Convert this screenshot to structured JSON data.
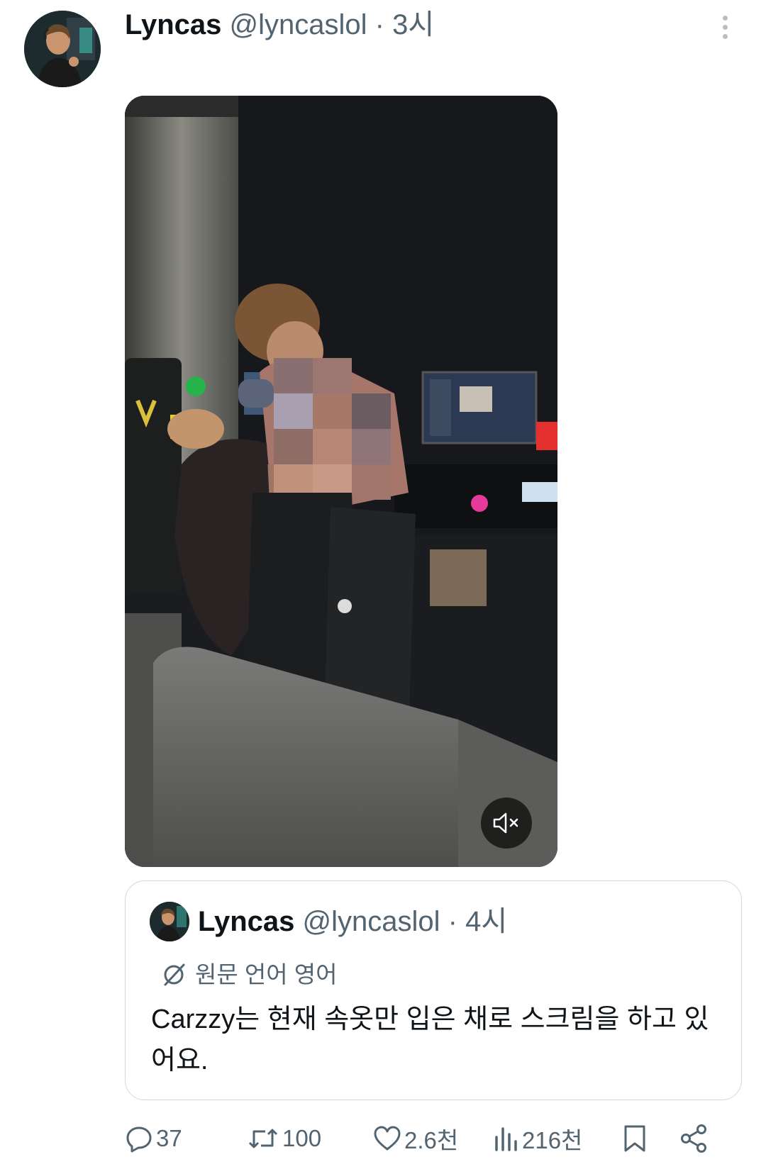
{
  "tweet": {
    "author_name": "Lyncas",
    "author_handle": "@lyncaslol",
    "separator": "·",
    "time": "3시",
    "more_icon": "more-vertical-icon"
  },
  "media": {
    "kind": "video",
    "mute_icon": "volume-muted-icon"
  },
  "quoted_tweet": {
    "author_name": "Lyncas",
    "author_handle": "@lyncaslol",
    "separator": "·",
    "time": "4시",
    "translation_notice": "원문 언어 영어",
    "translation_icon": "translate-icon",
    "text": "Carzzy는 현재 속옷만 입은 채로 스크림을 하고 있어요."
  },
  "actions": {
    "reply_count": "37",
    "retweet_count": "100",
    "like_count": "2.6천",
    "view_count": "216천"
  },
  "colors": {
    "text_primary": "#0f1419",
    "text_secondary": "#536471",
    "border": "#cfd9de"
  }
}
